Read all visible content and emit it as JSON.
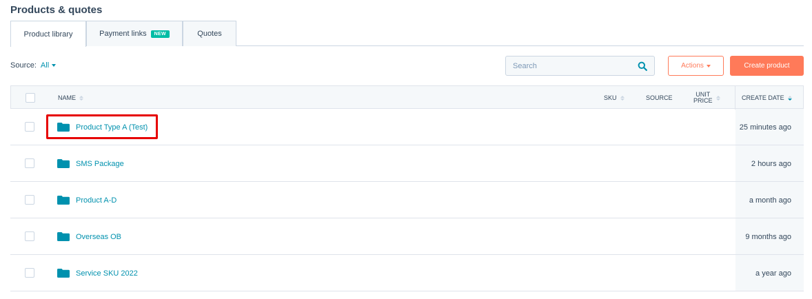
{
  "page": {
    "title": "Products & quotes"
  },
  "tabs": [
    {
      "label": "Product library",
      "active": true
    },
    {
      "label": "Payment links",
      "badge": "NEW",
      "active": false
    },
    {
      "label": "Quotes",
      "active": false
    }
  ],
  "filters": {
    "source_label": "Source:",
    "source_value": "All"
  },
  "search": {
    "placeholder": "Search",
    "value": ""
  },
  "toolbar": {
    "actions_label": "Actions",
    "create_label": "Create product"
  },
  "table": {
    "columns": {
      "name": "NAME",
      "sku": "SKU",
      "source": "SOURCE",
      "unit_price_line1": "UNIT",
      "unit_price_line2": "PRICE",
      "create_date": "CREATE DATE"
    },
    "rows": [
      {
        "name": "Product Type A (Test)",
        "create_date": "25 minutes ago",
        "highlighted": true
      },
      {
        "name": "SMS Package",
        "create_date": "2 hours ago"
      },
      {
        "name": "Product A-D",
        "create_date": "a month ago"
      },
      {
        "name": "Overseas OB",
        "create_date": "9 months ago"
      },
      {
        "name": "Service SKU 2022",
        "create_date": "a year ago"
      }
    ]
  },
  "colors": {
    "accent": "#0091ae",
    "brand": "#ff7a59",
    "badge": "#00bda5",
    "highlight": "#e60000",
    "folder": "#0091ae"
  },
  "icons": {
    "search": "search-icon",
    "folder": "folder-icon",
    "sort": "sort-icon"
  }
}
